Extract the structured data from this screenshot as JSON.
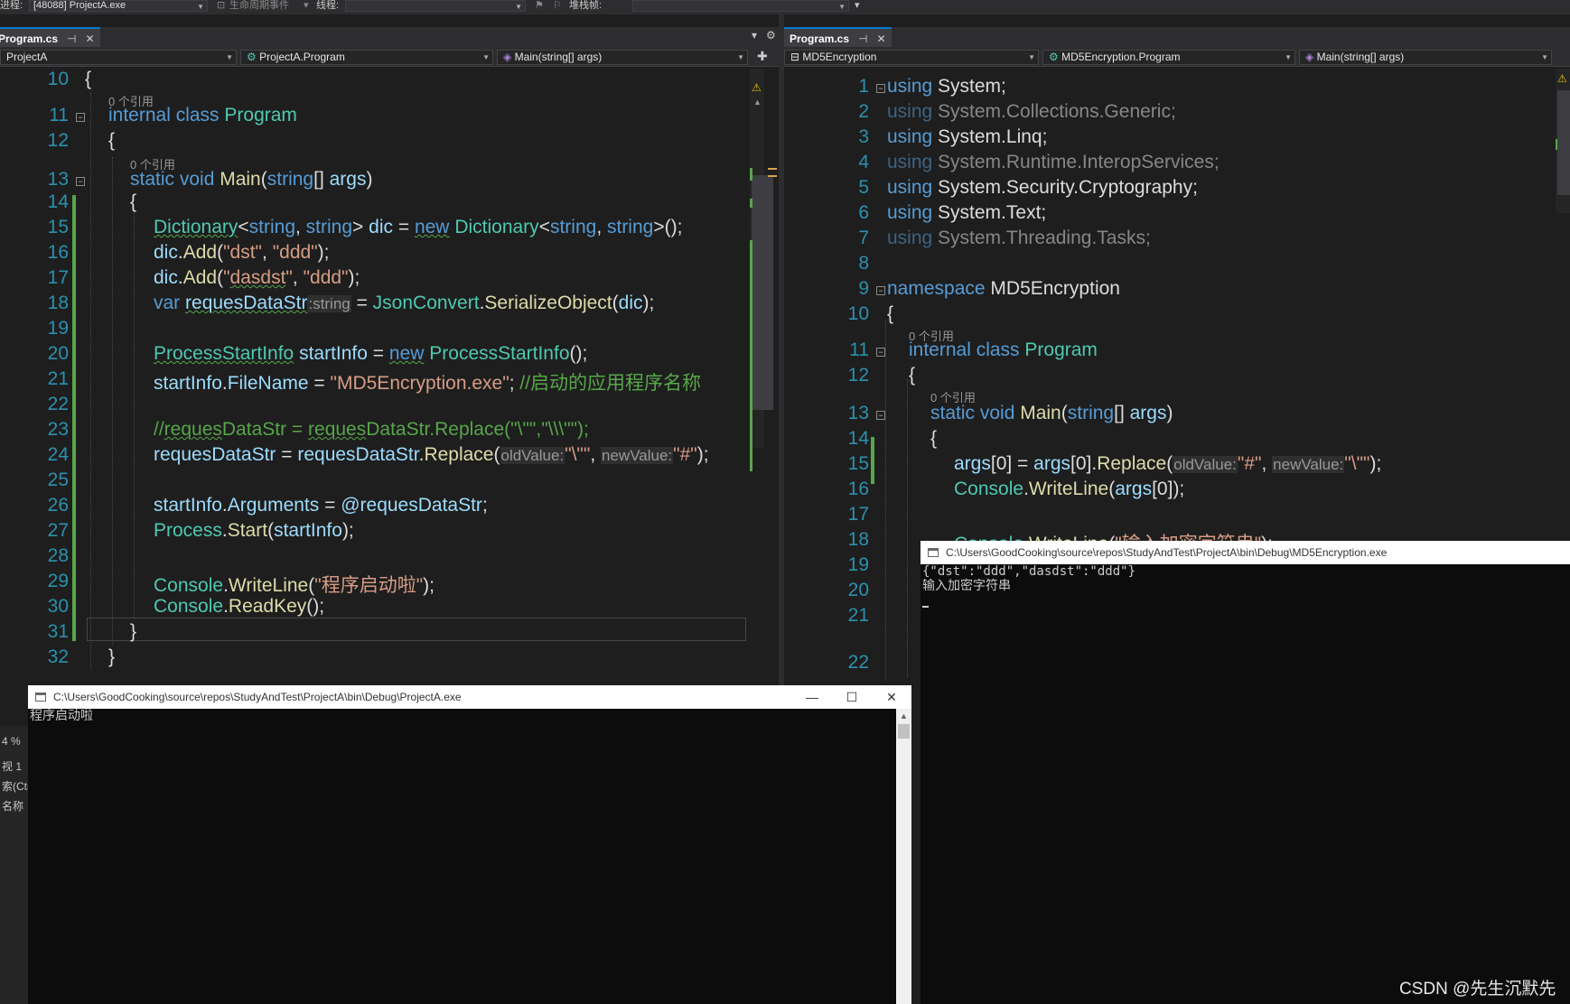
{
  "toolbar": {
    "process_label": "进程:",
    "process_value": "[48088] ProjectA.exe",
    "lifecycle_label": "生命周期事件",
    "thread_label": "线程:",
    "stackframe_label": "堆栈帧:"
  },
  "left": {
    "tab_title": "Program.cs",
    "nav_project": "ProjectA",
    "nav_class": "ProjectA.Program",
    "nav_member": "Main(string[] args)",
    "codelens": [
      "0 个引用",
      "0 个引用"
    ],
    "line_numbers": [
      "10",
      "11",
      "12",
      "13",
      "14",
      "15",
      "16",
      "17",
      "18",
      "19",
      "20",
      "21",
      "22",
      "23",
      "24",
      "25",
      "26",
      "27",
      "28",
      "29",
      "30",
      "31",
      "32"
    ]
  },
  "right": {
    "tab_title": "Program.cs",
    "nav_project": "MD5Encryption",
    "nav_class": "MD5Encryption.Program",
    "nav_member": "Main(string[] args)",
    "codelens": [
      "0 个引用",
      "0 个引用"
    ],
    "line_numbers": [
      "1",
      "2",
      "3",
      "4",
      "5",
      "6",
      "7",
      "8",
      "9",
      "10",
      "11",
      "12",
      "13",
      "14",
      "15",
      "16",
      "17",
      "18",
      "19",
      "20",
      "21",
      "22"
    ]
  },
  "console_a": {
    "title": "C:\\Users\\GoodCooking\\source\\repos\\StudyAndTest\\ProjectA\\bin\\Debug\\ProjectA.exe",
    "lines": [
      "程序启动啦"
    ]
  },
  "console_b": {
    "title": "C:\\Users\\GoodCooking\\source\\repos\\StudyAndTest\\ProjectA\\bin\\Debug\\MD5Encryption.exe",
    "lines": [
      "{\"dst\":\"ddd\",\"dasdst\":\"ddd\"}",
      "输入加密字符串"
    ]
  },
  "side_fragment": [
    "4 %",
    "视 1",
    "索(Ctr",
    "名称"
  ],
  "watermark": "CSDN @先生沉默先",
  "colors": {
    "keyword": "#569cd6",
    "type": "#4ec9b0",
    "string": "#d69d85",
    "comment": "#57a64a",
    "line_number": "#2b91af",
    "change_bar": "#57a64a"
  }
}
